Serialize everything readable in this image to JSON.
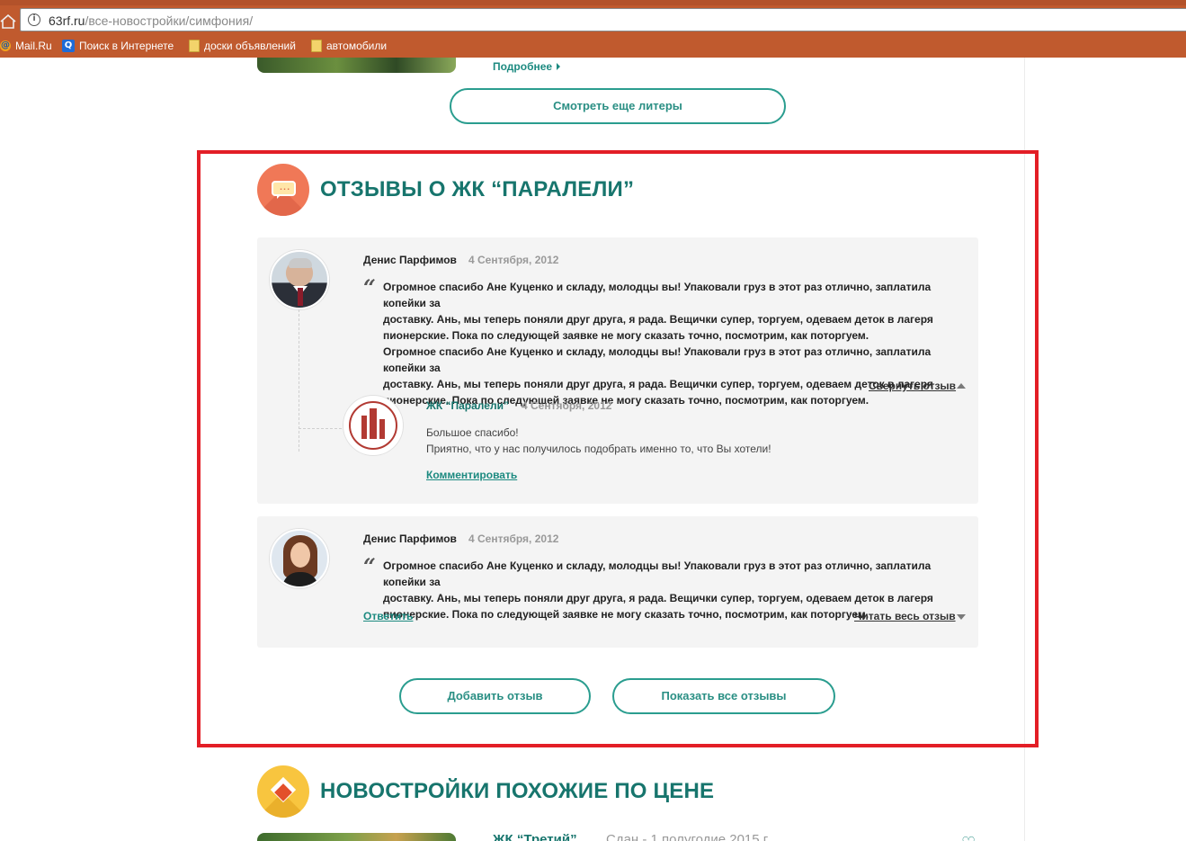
{
  "browser": {
    "url_host": "63rf.ru",
    "url_path": "/все-новостройки/симфония/",
    "bookmarks": [
      {
        "label": "Mail.Ru",
        "icon": "mailru-icon"
      },
      {
        "label": "Поиск в Интернете",
        "icon": "search-icon"
      },
      {
        "label": "доски объявлений",
        "icon": "folder-icon"
      },
      {
        "label": "автомобили",
        "icon": "folder-icon"
      }
    ]
  },
  "literals": {
    "more_link": "Подробнее",
    "show_more_button": "Смотреть еще литеры"
  },
  "reviews": {
    "title": "ОТЗЫВЫ О ЖК “ПАРАЛЕЛИ”",
    "items": [
      {
        "author": "Денис Парфимов",
        "date": "4 Сентября, 2012",
        "text_lines": [
          "Огромное спасибо Ане Куценко и складу, молодцы вы! Упаковали груз в этот раз отлично, заплатила копейки за",
          "доставку. Ань, мы теперь поняли друг друга, я рада. Вещички супер, торгуем, одеваем деток в лагеря",
          "пионерские. Пока по следующей заявке не могу сказать точно, посмотрим, как поторгуем.",
          "Огромное спасибо Ане Куценко и складу, молодцы вы! Упаковали груз в этот раз отлично, заплатила копейки за",
          "доставку. Ань, мы теперь поняли друг друга, я рада. Вещички супер, торгуем, одеваем деток в лагеря",
          "пионерские. Пока по следующей заявке не могу сказать точно, посмотрим, как поторгуем."
        ],
        "collapse_label": "Свернуть отзыв",
        "reply": {
          "author": "ЖК “Паралели”",
          "date": "4 Сентября, 2012",
          "text_lines": [
            "Большое спасибо!",
            "Приятно, что у нас получилось подобрать именно то, что Вы хотели!"
          ],
          "comment_label": "Комментировать"
        }
      },
      {
        "author": "Денис Парфимов",
        "date": "4 Сентября, 2012",
        "text_lines": [
          "Огромное спасибо Ане Куценко и складу, молодцы вы! Упаковали груз в этот раз отлично, заплатила копейки за",
          "доставку. Ань, мы теперь поняли друг друга, я рада. Вещички супер, торгуем, одеваем деток в лагеря",
          "пионерские. Пока по следующей заявке не могу сказать точно, посмотрим, как поторгуем."
        ],
        "reply_label": "Ответить",
        "expand_label": "Читать весь отзыв"
      }
    ],
    "add_button": "Добавить отзыв",
    "show_all_button": "Показать все отзывы"
  },
  "similar": {
    "title": "НОВОСТРОЙКИ ПОХОЖИЕ ПО ЦЕНЕ",
    "first_item_title": "ЖК “Третий”",
    "first_item_meta": "Сдан - 1 полугодие 2015 г."
  },
  "colors": {
    "accent_teal": "#17756d",
    "button_border": "#2a9d8f",
    "highlight_red": "#e31e26",
    "browser_bar": "#c05a2e"
  }
}
